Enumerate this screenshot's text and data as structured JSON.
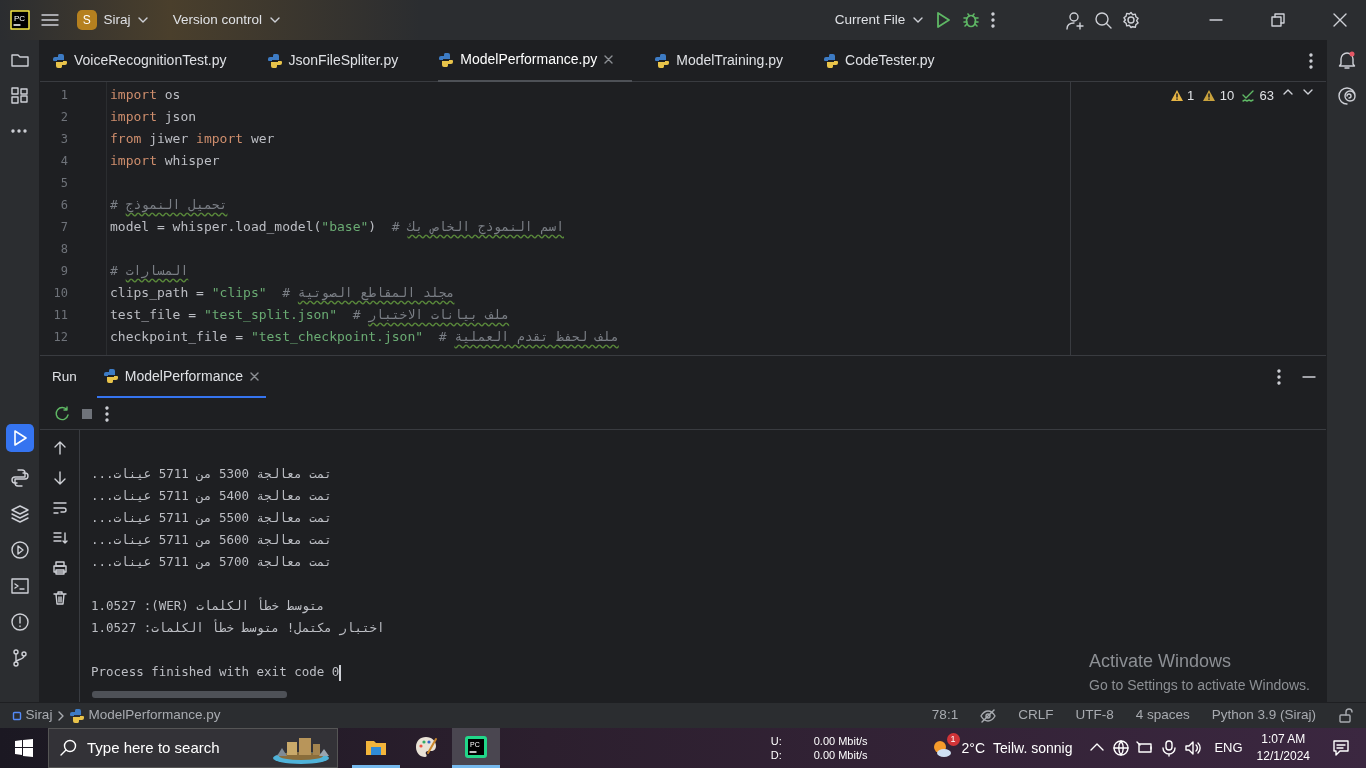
{
  "title_bar": {
    "logo_text": "PC",
    "project_initial": "S",
    "project": "Siraj",
    "vcs": "Version control",
    "run_config": "Current File"
  },
  "editor_tabs": [
    {
      "label": "VoiceRecognitionTest.py",
      "selected": false
    },
    {
      "label": "JsonFileSpliter.py",
      "selected": false
    },
    {
      "label": "ModelPerformance.py",
      "selected": true
    },
    {
      "label": "ModelTraining.py",
      "selected": false
    },
    {
      "label": "CodeTester.py",
      "selected": false
    }
  ],
  "inspections": [
    {
      "kind": "error",
      "count": "1"
    },
    {
      "kind": "warning",
      "count": "10"
    },
    {
      "kind": "typo",
      "count": "63"
    }
  ],
  "code_lines": [
    {
      "number": "1",
      "tokens": [
        {
          "kind": "keyword",
          "text": "import"
        },
        {
          "kind": "plain",
          "text": " os"
        }
      ]
    },
    {
      "number": "2",
      "tokens": [
        {
          "kind": "keyword",
          "text": "import"
        },
        {
          "kind": "plain",
          "text": " json"
        }
      ]
    },
    {
      "number": "3",
      "tokens": [
        {
          "kind": "keyword",
          "text": "from"
        },
        {
          "kind": "plain",
          "text": " jiwer "
        },
        {
          "kind": "keyword",
          "text": "import"
        },
        {
          "kind": "plain",
          "text": " wer"
        }
      ]
    },
    {
      "number": "4",
      "tokens": [
        {
          "kind": "keyword",
          "text": "import"
        },
        {
          "kind": "plain",
          "text": " whisper"
        }
      ]
    },
    {
      "number": "5"
    },
    {
      "number": "6",
      "tokens": [
        {
          "kind": "comment",
          "text": "# "
        },
        {
          "kind": "typo",
          "text": "تحميل النموذج"
        }
      ]
    },
    {
      "number": "7",
      "tokens": [
        {
          "kind": "plain",
          "text": "model = whisper.load_model("
        },
        {
          "kind": "string",
          "text": "\"base\""
        },
        {
          "kind": "plain",
          "text": ")  "
        },
        {
          "kind": "comment",
          "text": "# "
        },
        {
          "kind": "typo",
          "text": "اسم النموذج الخاص بك"
        }
      ]
    },
    {
      "number": "8"
    },
    {
      "number": "9",
      "tokens": [
        {
          "kind": "comment",
          "text": "# "
        },
        {
          "kind": "typo",
          "text": "المسارات"
        }
      ]
    },
    {
      "number": "10",
      "tokens": [
        {
          "kind": "plain",
          "text": "clips_path = "
        },
        {
          "kind": "string",
          "text": "\"clips\""
        },
        {
          "kind": "comment",
          "text": "  # "
        },
        {
          "kind": "typo",
          "text": "مجلد المقاطع الصوتية"
        }
      ]
    },
    {
      "number": "11",
      "tokens": [
        {
          "kind": "plain",
          "text": "test_file = "
        },
        {
          "kind": "string",
          "text": "\"test_split.json\""
        },
        {
          "kind": "comment",
          "text": "  # "
        },
        {
          "kind": "typo",
          "text": "ملف بيانات الاختبار"
        }
      ]
    },
    {
      "number": "12",
      "tokens": [
        {
          "kind": "plain",
          "text": "checkpoint_file = "
        },
        {
          "kind": "string",
          "text": "\"test_checkpoint.json\""
        },
        {
          "kind": "comment",
          "text": "  # "
        },
        {
          "kind": "typo",
          "text": "ملف لحفظ تقدم العملية"
        }
      ]
    }
  ],
  "run_panel": {
    "title": "Run",
    "tabs": [
      {
        "label": "ModelPerformance",
        "selected": true
      }
    ],
    "output": [
      {
        "kind": "rtl",
        "text": "تمت معالجة 5300 من 5711 عينات..."
      },
      {
        "kind": "rtl",
        "text": "تمت معالجة 5400 من 5711 عينات..."
      },
      {
        "kind": "rtl",
        "text": "تمت معالجة 5500 من 5711 عينات..."
      },
      {
        "kind": "rtl",
        "text": "تمت معالجة 5600 من 5711 عينات..."
      },
      {
        "kind": "rtl",
        "text": "تمت معالجة 5700 من 5711 عينات..."
      },
      {
        "kind": "blank"
      },
      {
        "kind": "rtl",
        "text": "متوسط خطأ الكلمات (WER): 1.0527"
      },
      {
        "kind": "rtl",
        "text": "اختبار مكتمل! متوسط خطأ الكلمات: 1.0527"
      },
      {
        "kind": "blank"
      },
      {
        "kind": "ltr",
        "text": "Process finished with exit code 0"
      }
    ]
  },
  "watermark": {
    "title": "Activate Windows",
    "subtitle": "Go to Settings to activate Windows."
  },
  "status_bar": {
    "breadcrumbs": [
      "Siraj",
      "ModelPerformance.py"
    ],
    "items": [
      "78:1",
      "CRLF",
      "UTF-8",
      "4 spaces",
      "Python 3.9 (Siraj)"
    ]
  },
  "taskbar": {
    "search_placeholder": "Type here to search",
    "apps": [
      {
        "kind": "folder",
        "running": true,
        "active": false
      },
      {
        "kind": "palette",
        "running": false,
        "active": false
      },
      {
        "kind": "ide",
        "label": "PC",
        "running": true,
        "active": true
      }
    ],
    "net_up_label": "U:",
    "net_up": "0.00 Mbit/s",
    "net_down_label": "D:",
    "net_down": "0.00 Mbit/s",
    "weather_badge": "1",
    "temperature": "2°C",
    "weather": "Teilw. sonnig",
    "language": "ENG",
    "time": "1:07 AM",
    "date": "12/1/2024"
  }
}
